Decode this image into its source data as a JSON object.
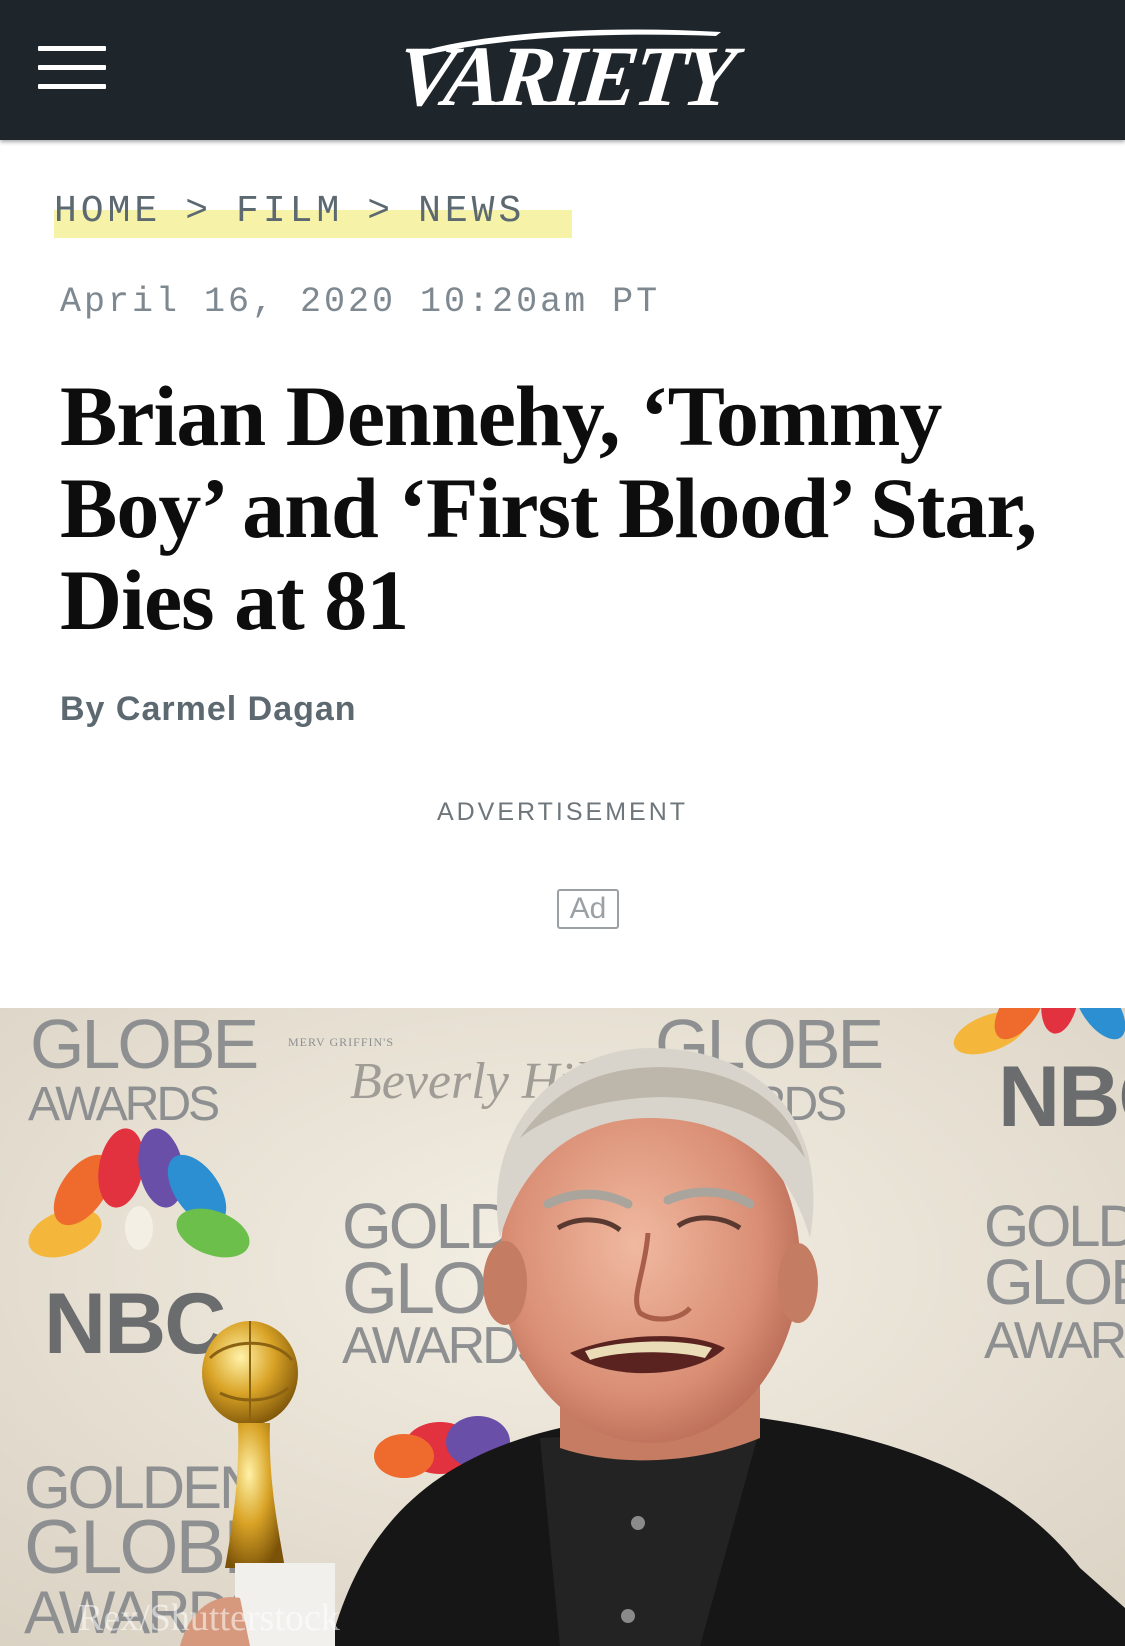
{
  "header": {
    "menu_icon": "hamburger-menu-icon",
    "logo_text": "VARIETY",
    "background": "#1f262b"
  },
  "breadcrumb": {
    "items": [
      "HOME",
      "FILM",
      "NEWS"
    ],
    "separator": ">"
  },
  "article": {
    "date": "April 16, 2020 10:20am PT",
    "headline": "Brian Dennehy, ‘Tommy Boy’ and ‘First Blood’ Star, Dies at 81",
    "byline": "By Carmel Dagan"
  },
  "advertisement": {
    "label": "ADVERTISEMENT",
    "badge": "Ad"
  },
  "photo": {
    "backdrop_text": {
      "globe": "GLOBE",
      "awards": "AWARDS",
      "golden": "GOLDEN",
      "nbc": "NBC",
      "merv": "MERV GRIFFIN'S",
      "beverly": "Beverly Hilton"
    },
    "credit": "Rex/Shutterstock"
  }
}
